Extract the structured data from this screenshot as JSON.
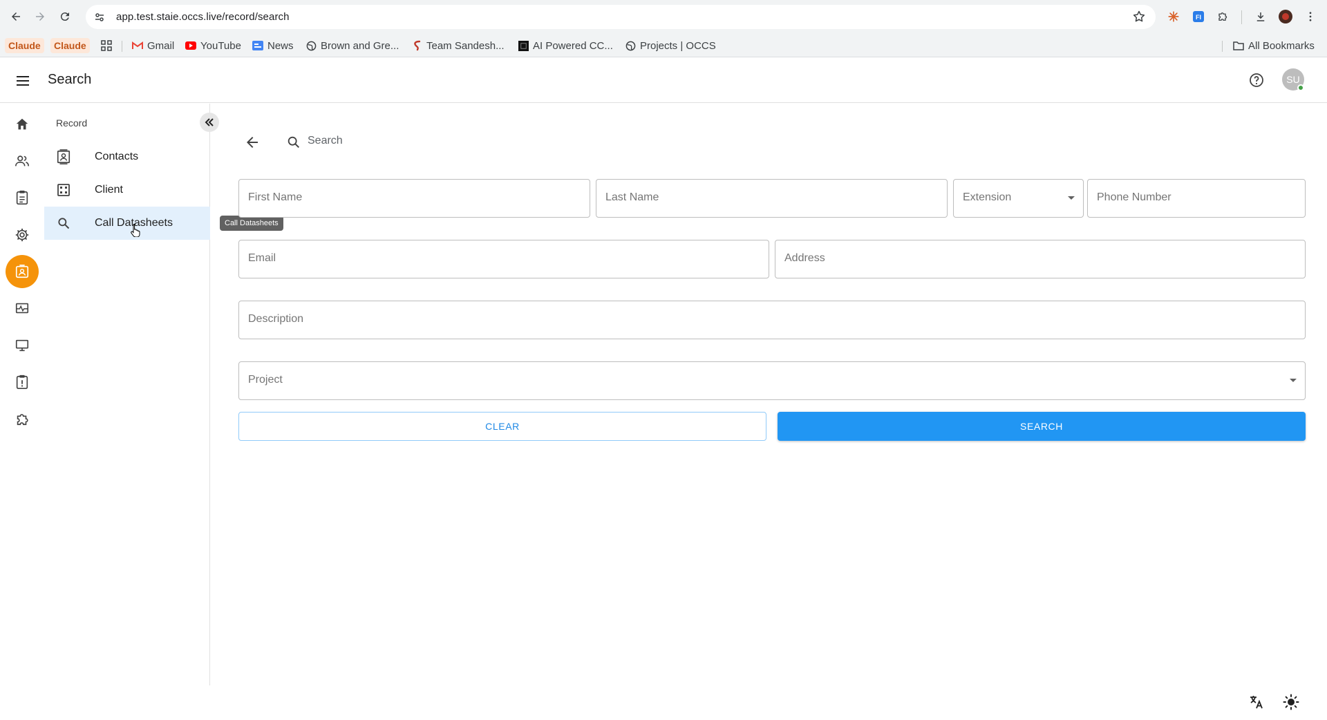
{
  "browser": {
    "url": "app.test.staie.occs.live/record/search",
    "bookmarks": [
      {
        "label": "Claude",
        "icon": "claude-icon"
      },
      {
        "label": "Claude",
        "icon": "claude-icon"
      },
      {
        "label": "Gmail",
        "icon": "gmail-icon"
      },
      {
        "label": "YouTube",
        "icon": "youtube-icon"
      },
      {
        "label": "News",
        "icon": "news-icon"
      },
      {
        "label": "Brown and Gre...",
        "icon": "globe-icon"
      },
      {
        "label": "Team Sandesh...",
        "icon": "sandesh-icon"
      },
      {
        "label": "AI Powered CC...",
        "icon": "ai-icon"
      },
      {
        "label": "Projects | OCCS",
        "icon": "globe-icon"
      }
    ],
    "all_bookmarks": "All Bookmarks"
  },
  "header": {
    "title": "Search",
    "avatar_initials": "SU"
  },
  "subnav": {
    "heading": "Record",
    "items": [
      {
        "label": "Contacts",
        "icon": "contacts-icon"
      },
      {
        "label": "Client",
        "icon": "client-icon"
      },
      {
        "label": "Call Datasheets",
        "icon": "search-icon"
      }
    ],
    "active_index": 2,
    "tooltip": "Call Datasheets"
  },
  "search": {
    "label": "Search"
  },
  "form": {
    "first_name": "First Name",
    "last_name": "Last Name",
    "extension": "Extension",
    "phone_number": "Phone Number",
    "email": "Email",
    "address": "Address",
    "description": "Description",
    "project": "Project"
  },
  "buttons": {
    "clear": "CLEAR",
    "search": "SEARCH"
  },
  "colors": {
    "accent": "#2196f3",
    "rail_active": "#f5930a",
    "subnav_active": "#e3f0fc"
  }
}
